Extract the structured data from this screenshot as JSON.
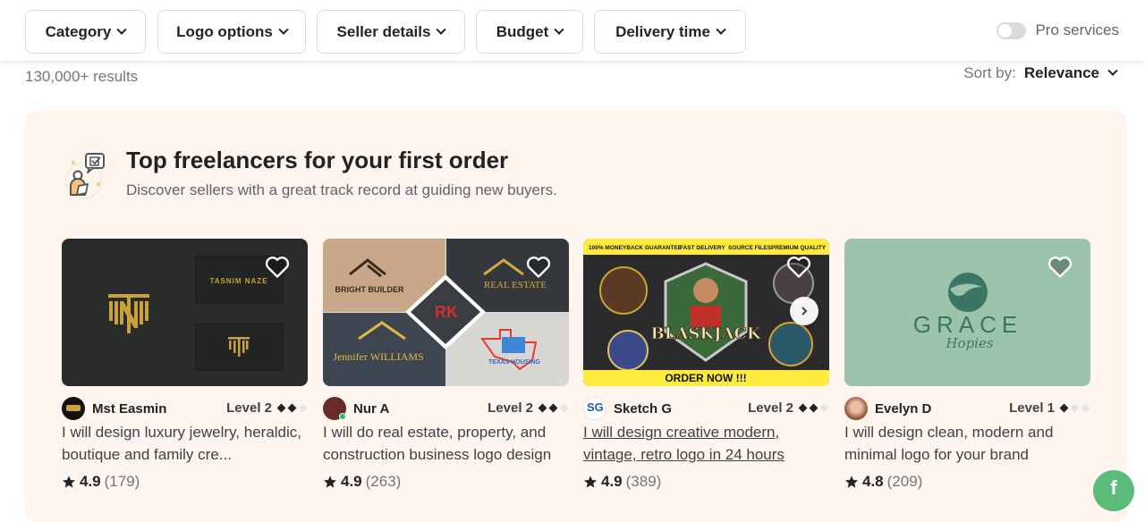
{
  "filters": [
    {
      "label": "Category"
    },
    {
      "label": "Logo options"
    },
    {
      "label": "Seller details"
    },
    {
      "label": "Budget"
    },
    {
      "label": "Delivery time"
    }
  ],
  "pro_services": {
    "label": "Pro services",
    "enabled": false
  },
  "results_count": "130,000+ results",
  "sort": {
    "label": "Sort by:",
    "value": "Relevance"
  },
  "section": {
    "title": "Top freelancers for your first order",
    "subtitle": "Discover sellers with a great track record at guiding new buyers."
  },
  "cards": [
    {
      "seller": "Mst Easmin",
      "level": "Level 2",
      "level_filled": 2,
      "level_total": 3,
      "title": "I will design luxury jewelry, heraldic, boutique and family cre...",
      "rating": "4.9",
      "reviews": "(179)",
      "image_text": [
        "TASNIM NAZE"
      ],
      "online": false
    },
    {
      "seller": "Nur A",
      "level": "Level 2",
      "level_filled": 2,
      "level_total": 3,
      "title": "I will do real estate, property, and construction business logo design",
      "rating": "4.9",
      "reviews": "(263)",
      "image_text": [
        "BRIGHT BUILDER",
        "REAL ESTATE",
        "RK",
        "Jennifer WILLIAMS",
        "TEXAS HOUSING"
      ],
      "online": true
    },
    {
      "seller": "Sketch G",
      "level": "Level 2",
      "level_filled": 2,
      "level_total": 3,
      "title": "I will design creative modern, vintage, retro logo in 24 hours",
      "rating": "4.9",
      "reviews": "(389)",
      "image_text": [
        "100% MONEYBACK GUARANTEE",
        "FAST DELIVERY",
        "SOURCE FILES",
        "PREMIUM QUALITY",
        "BLASKJACK",
        "ORDER NOW !!!"
      ],
      "online": false
    },
    {
      "seller": "Evelyn D",
      "level": "Level 1",
      "level_filled": 1,
      "level_total": 3,
      "title": "I will design clean, modern and minimal logo for your brand",
      "rating": "4.8",
      "reviews": "(209)",
      "image_text": [
        "GRACE",
        "Hopies"
      ],
      "online": false
    }
  ],
  "chat_fab": {
    "label": "f"
  },
  "colors": {
    "panel_bg": "#fdf5ee",
    "accent_green": "#5bbb7b",
    "text_dark": "#222325",
    "text_muted": "#74767e"
  }
}
